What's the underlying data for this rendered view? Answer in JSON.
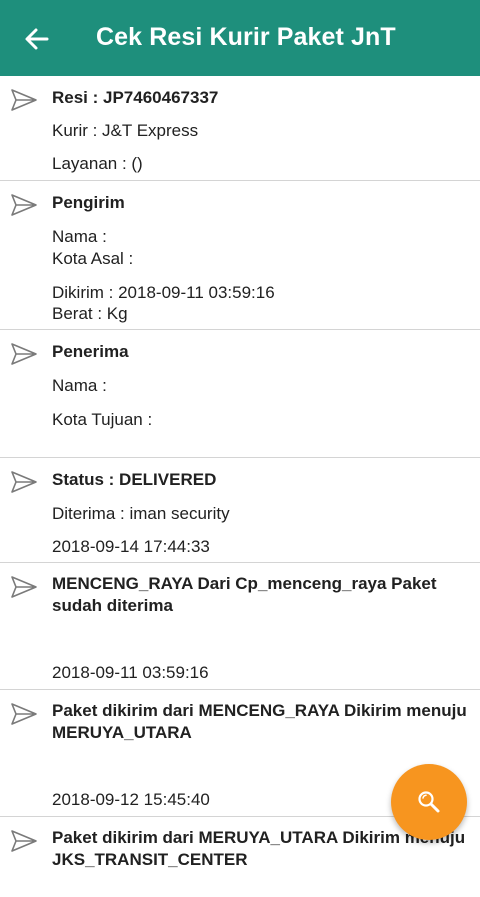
{
  "header": {
    "title": "Cek Resi Kurir Paket JnT"
  },
  "resi": {
    "title": "Resi : JP7460467337",
    "kurir": "Kurir : J&T Express",
    "layanan": "Layanan :  ()"
  },
  "pengirim": {
    "title": "Pengirim",
    "nama": "Nama :",
    "kota": "Kota Asal :",
    "dikirim": "Dikirim : 2018-09-11 03:59:16",
    "berat": "Berat :  Kg"
  },
  "penerima": {
    "title": "Penerima",
    "nama": "Nama :",
    "kota": "Kota Tujuan :"
  },
  "status": {
    "title": "Status : DELIVERED",
    "diterima": "Diterima : iman security",
    "time": "2018-09-14 17:44:33"
  },
  "history": [
    {
      "text": "MENCENG_RAYA Dari Cp_menceng_raya Paket sudah diterima",
      "time": "2018-09-11 03:59:16"
    },
    {
      "text": "Paket dikirim dari MENCENG_RAYA Dikirim menuju MERUYA_UTARA",
      "time": "2018-09-12 15:45:40"
    },
    {
      "text": "Paket dikirim dari MERUYA_UTARA Dikirim menuju JKS_TRANSIT_CENTER",
      "time": ""
    }
  ],
  "icons": {
    "back": "arrow-back-icon",
    "item": "send-icon",
    "fab": "search-icon"
  },
  "colors": {
    "appbar": "#1e8f7c",
    "fab": "#f7951f",
    "divider": "#d4d4d4",
    "icon": "#7a7a7a"
  }
}
